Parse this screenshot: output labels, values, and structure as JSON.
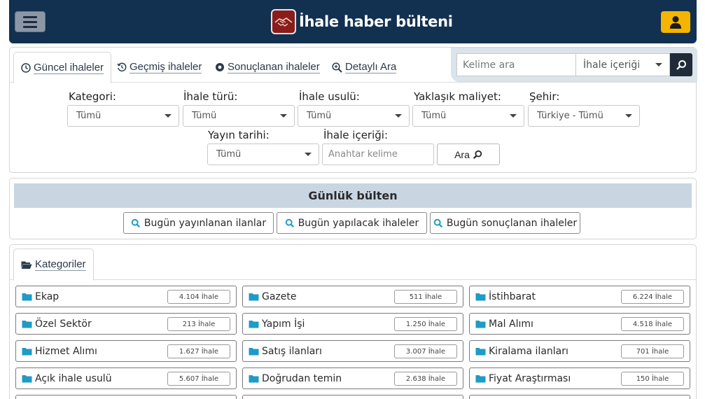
{
  "header": {
    "title": "İhale haber bülteni",
    "menu_icon": "hamburger-menu-icon",
    "logo_icon": "handshake-logo-icon",
    "user_icon": "user-icon",
    "colors": {
      "bar": "#12304f",
      "user_button": "#f4b400"
    }
  },
  "tabs": [
    {
      "label": "Güncel ihaleler",
      "icon": "clock-icon",
      "active": true
    },
    {
      "label": "Geçmiş ihaleler",
      "icon": "history-icon"
    },
    {
      "label": "Sonuçlanan ihaleler",
      "icon": "record-icon"
    },
    {
      "label": "Detaylı Ara",
      "icon": "zoom-in-icon"
    }
  ],
  "quick_search": {
    "placeholder": "Kelime ara",
    "scope": "İhale içeriği"
  },
  "filters": {
    "kategori": {
      "label": "Kategori:",
      "value": "Tümü"
    },
    "ihale_turu": {
      "label": "İhale türü:",
      "value": "Tümü"
    },
    "ihale_usulu": {
      "label": "İhale usulü:",
      "value": "Tümü"
    },
    "yaklasik_maliyet": {
      "label": "Yaklaşık maliyet:",
      "value": "Tümü"
    },
    "sehir": {
      "label": "Şehir:",
      "value": "Türkiye - Tümü"
    },
    "yayin_tarihi": {
      "label": "Yayın tarihi:",
      "value": "Tümü"
    },
    "ihale_icerigi": {
      "label": "İhale içeriği:",
      "placeholder": "Anahtar kelime"
    },
    "search_button": "Ara"
  },
  "bulletin": {
    "title": "Günlük bülten",
    "buttons": [
      "Bugün yayınlanan ilanlar",
      "Bugün yapılacak ihaleler",
      "Bugün sonuçlanan ihaleler"
    ]
  },
  "categories": {
    "tab_label": "Kategoriler",
    "items": [
      {
        "name": "Ekap",
        "count": "4.104 İhale"
      },
      {
        "name": "Gazete",
        "count": "511 İhale"
      },
      {
        "name": "İstihbarat",
        "count": "6.224 İhale"
      },
      {
        "name": "Özel Sektör",
        "count": "213 İhale"
      },
      {
        "name": "Yapım İşi",
        "count": "1.250 İhale"
      },
      {
        "name": "Mal Alımı",
        "count": "4.518 İhale"
      },
      {
        "name": "Hizmet Alımı",
        "count": "1.627 İhale"
      },
      {
        "name": "Satış ilanları",
        "count": "3.007 İhale"
      },
      {
        "name": "Kiralama ilanları",
        "count": "701 İhale"
      },
      {
        "name": "Açık ihale usulü",
        "count": "5.607 İhale"
      },
      {
        "name": "Doğrudan temin",
        "count": "2.638 İhale"
      },
      {
        "name": "Fiyat Araştırması",
        "count": "150 İhale"
      }
    ]
  }
}
